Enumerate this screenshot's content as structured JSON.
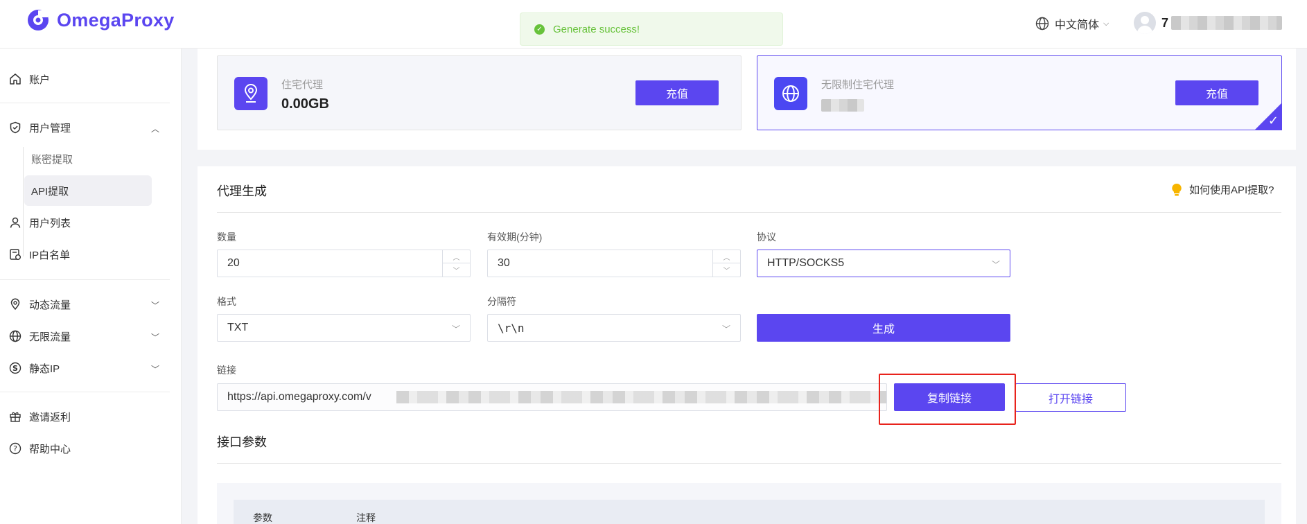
{
  "header": {
    "brand": "OmegaProxy",
    "toast": "Generate success!",
    "language": "中文简体",
    "user_initial": "7"
  },
  "sidebar": {
    "account": "账户",
    "user_management": "用户管理",
    "sub_password_extract": "账密提取",
    "sub_api_extract": "API提取",
    "user_list": "用户列表",
    "ip_whitelist": "IP白名单",
    "dynamic_traffic": "动态流量",
    "unlimited_traffic": "无限流量",
    "static_ip": "静态IP",
    "invite_rebate": "邀请返利",
    "help_center": "帮助中心"
  },
  "cards": [
    {
      "label": "住宅代理",
      "value": "0.00GB",
      "button": "充值",
      "icon": "location-pin-icon",
      "selected": false
    },
    {
      "label": "无限制住宅代理",
      "value": "",
      "button": "充值",
      "icon": "globe-icon",
      "selected": true
    }
  ],
  "generate": {
    "title": "代理生成",
    "help_link": "如何使用API提取?",
    "quantity_label": "数量",
    "quantity_value": "20",
    "validity_label": "有效期(分钟)",
    "validity_value": "30",
    "protocol_label": "协议",
    "protocol_value": "HTTP/SOCKS5",
    "format_label": "格式",
    "format_value": "TXT",
    "separator_label": "分隔符",
    "separator_value": "\\r\\n",
    "generate_button": "生成",
    "link_label": "链接",
    "link_value": "https://api.omegaproxy.com/v",
    "copy_button": "复制链接",
    "open_button": "打开链接"
  },
  "params": {
    "title": "接口参数",
    "col_param": "参数",
    "col_note": "注释"
  },
  "colors": {
    "accent": "#5b46f0",
    "success": "#67c23a",
    "highlight": "#e8231c"
  }
}
